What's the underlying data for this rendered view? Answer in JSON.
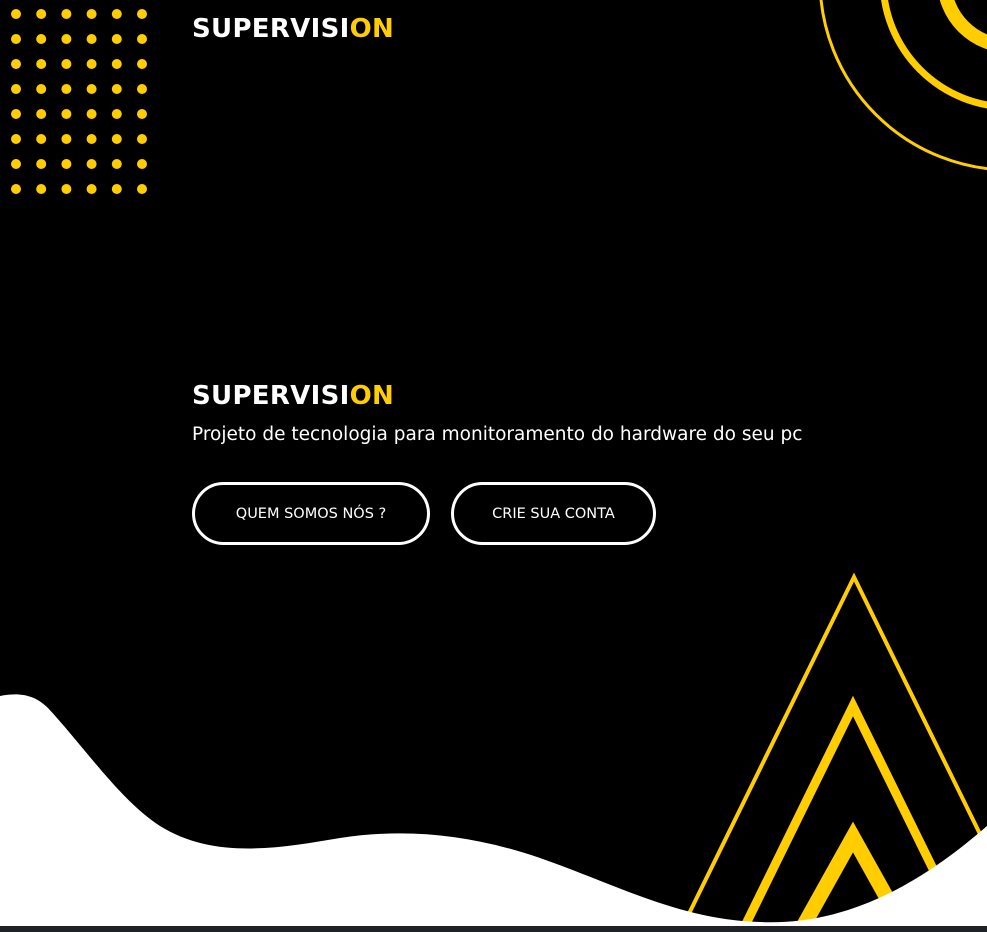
{
  "brand": {
    "name_main": "SUPERVISI",
    "name_accent": "ON"
  },
  "hero": {
    "title_main": "SUPERVISI",
    "title_accent": "ON",
    "subtitle": "Projeto de tecnologia para monitoramento do hardware do seu pc"
  },
  "buttons": {
    "about_label": "QUEM SOMOS NÓS ?",
    "signup_label": "CRIE SUA CONTA"
  },
  "colors": {
    "background": "#000000",
    "accent": "#ffcd00",
    "text": "#ffffff",
    "wave": "#ffffff"
  },
  "decorations": {
    "dot_grid": "dot-grid-pattern",
    "arcs": "concentric-arcs",
    "triangles": "nested-triangles",
    "wave": "white-wave"
  }
}
